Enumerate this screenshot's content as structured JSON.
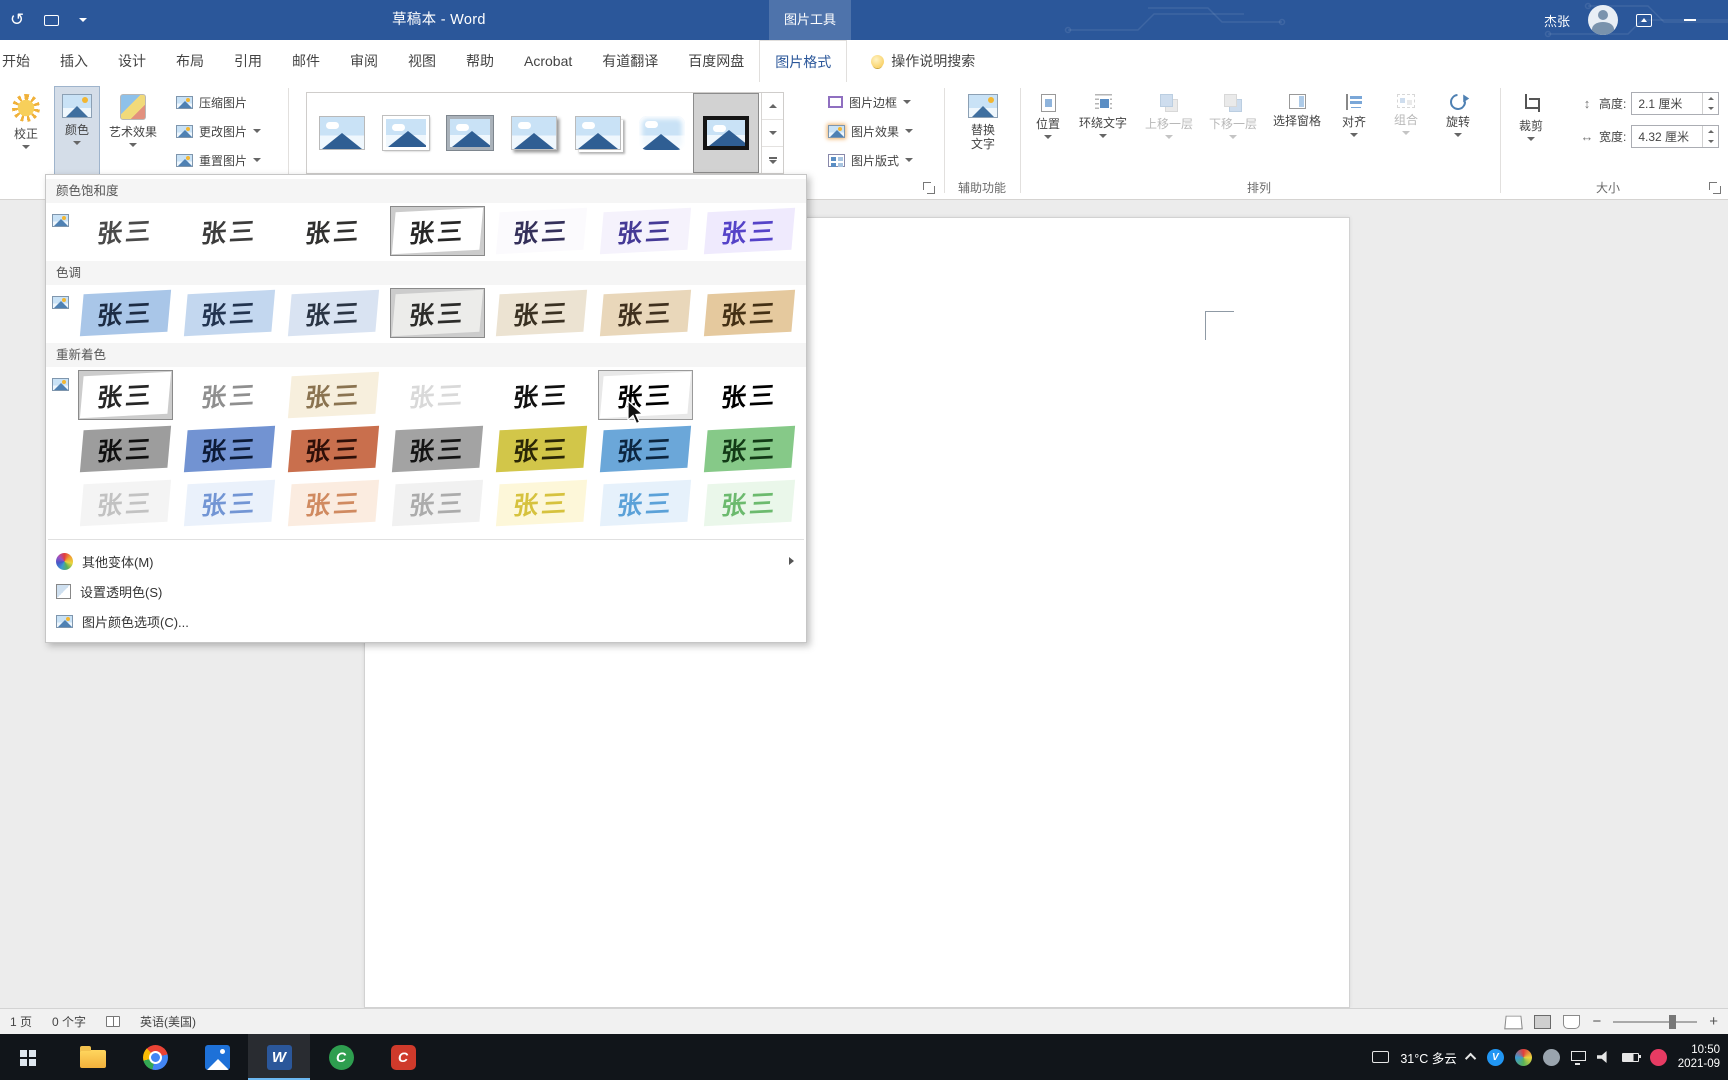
{
  "colors": {
    "titlebar_blue": "#2b579a",
    "contextual_tab_bg": "#4a76b9",
    "taskbar_dark": "#11151a",
    "selection_gray": "#cccccc"
  },
  "titlebar": {
    "document_title": "草稿本 - Word",
    "contextual_label": "图片工具",
    "user_name": "杰张"
  },
  "tabs": {
    "items": [
      {
        "name": "home",
        "label": "开始"
      },
      {
        "name": "insert",
        "label": "插入"
      },
      {
        "name": "design",
        "label": "设计"
      },
      {
        "name": "layout",
        "label": "布局"
      },
      {
        "name": "references",
        "label": "引用"
      },
      {
        "name": "mailings",
        "label": "邮件"
      },
      {
        "name": "review",
        "label": "审阅"
      },
      {
        "name": "view",
        "label": "视图"
      },
      {
        "name": "help",
        "label": "帮助"
      },
      {
        "name": "acrobat",
        "label": "Acrobat"
      },
      {
        "name": "youdao-translate",
        "label": "有道翻译"
      },
      {
        "name": "baidu-netdisk",
        "label": "百度网盘"
      },
      {
        "name": "picture-format",
        "label": "图片格式",
        "active": true
      }
    ],
    "search_label": "操作说明搜索"
  },
  "ribbon": {
    "correct_label": "校正",
    "color_label": "颜色",
    "artistic_label": "艺术效果",
    "compress_label": "压缩图片",
    "change_label": "更改图片",
    "reset_label": "重置图片",
    "styles_gallery": {
      "frames": [
        "simple",
        "bevel",
        "metal",
        "shadow",
        "stack",
        "soft",
        "black"
      ],
      "selected_index": 6
    },
    "border_label": "图片边框",
    "effects_label": "图片效果",
    "layout_label": "图片版式",
    "alt_text_label": "替换文字",
    "accessibility_group_label": "辅助功能",
    "arrange": {
      "position": "位置",
      "wrap": "环绕文字",
      "forward": "上移一层",
      "backward": "下移一层",
      "selection_pane": "选择窗格",
      "align": "对齐",
      "group": "组合",
      "rotate": "旋转",
      "group_label": "排列"
    },
    "size": {
      "crop": "裁剪",
      "height_label": "高度:",
      "height_value": "2.1 厘米",
      "width_label": "宽度:",
      "width_value": "4.32 厘米",
      "group_label": "大小"
    }
  },
  "color_menu": {
    "signature": "张三",
    "saturation": {
      "header": "颜色饱和度",
      "thumbs": [
        {
          "bg": "#ffffff",
          "ink": "#4a4a4a"
        },
        {
          "bg": "#ffffff",
          "ink": "#3c3c3c"
        },
        {
          "bg": "#ffffff",
          "ink": "#30302f"
        },
        {
          "bg": "#ffffff",
          "ink": "#262626",
          "state": "selected"
        },
        {
          "bg": "#fbfafd",
          "ink": "#34305a"
        },
        {
          "bg": "#f5f2fc",
          "ink": "#453a96"
        },
        {
          "bg": "#efeafd",
          "ink": "#5543c8"
        }
      ]
    },
    "tone": {
      "header": "色调",
      "thumbs": [
        {
          "bg": "#a9c6e8",
          "ink": "#1d2c44"
        },
        {
          "bg": "#c3d7ef",
          "ink": "#223450"
        },
        {
          "bg": "#d9e3f2",
          "ink": "#2a3444"
        },
        {
          "bg": "#ececea",
          "ink": "#2c2c2a",
          "state": "selected"
        },
        {
          "bg": "#ece3d2",
          "ink": "#3a3122"
        },
        {
          "bg": "#e9d7ba",
          "ink": "#40301e"
        },
        {
          "bg": "#e5c99e",
          "ink": "#443014"
        }
      ]
    },
    "recolor": {
      "header": "重新着色",
      "rows": [
        [
          {
            "bg": "#ffffff",
            "ink": "#262626",
            "state": "selected"
          },
          {
            "bg": "#ffffff",
            "ink": "#8f8f8f"
          },
          {
            "bg": "#f7efdd",
            "ink": "#8a7350"
          },
          {
            "bg": "#ffffff",
            "ink": "#d9d9d9"
          },
          {
            "bg": "#ffffff",
            "ink": "#111111"
          },
          {
            "bg": "#ffffff",
            "ink": "#000000",
            "state": "hover"
          },
          {
            "bg": "#ffffff",
            "ink": "#000000",
            "weight": "800"
          }
        ],
        [
          {
            "bg": "#9d9d9d",
            "ink": "#101010"
          },
          {
            "bg": "#7293d2",
            "ink": "#0c1a36"
          },
          {
            "bg": "#c96f4d",
            "ink": "#2e0f08"
          },
          {
            "bg": "#a3a3a3",
            "ink": "#141414"
          },
          {
            "bg": "#d2c649",
            "ink": "#2a2606"
          },
          {
            "bg": "#6ba7d9",
            "ink": "#0c2640"
          },
          {
            "bg": "#86c988",
            "ink": "#123a16"
          }
        ],
        [
          {
            "bg": "#f4f4f4",
            "ink": "#c2c2c2"
          },
          {
            "bg": "#eaf1fb",
            "ink": "#7295d4"
          },
          {
            "bg": "#fbece0",
            "ink": "#d08a60"
          },
          {
            "bg": "#f1f1f1",
            "ink": "#ababab"
          },
          {
            "bg": "#fdf7d9",
            "ink": "#d6c23e"
          },
          {
            "bg": "#e6f1fb",
            "ink": "#5ba1d8"
          },
          {
            "bg": "#eaf7ea",
            "ink": "#6cba6e"
          }
        ]
      ]
    },
    "items": [
      {
        "label": "其他变体(M)",
        "submenu": true
      },
      {
        "label": "设置透明色(S)",
        "submenu": false
      },
      {
        "label": "图片颜色选项(C)...",
        "submenu": false
      }
    ]
  },
  "statusbar": {
    "page": "1 页",
    "words": "0 个字",
    "language": "英语(美国)"
  },
  "taskbar": {
    "weather_temp": "31°C",
    "weather_desc": "多云",
    "time": "10:50",
    "date": "2021-09"
  }
}
